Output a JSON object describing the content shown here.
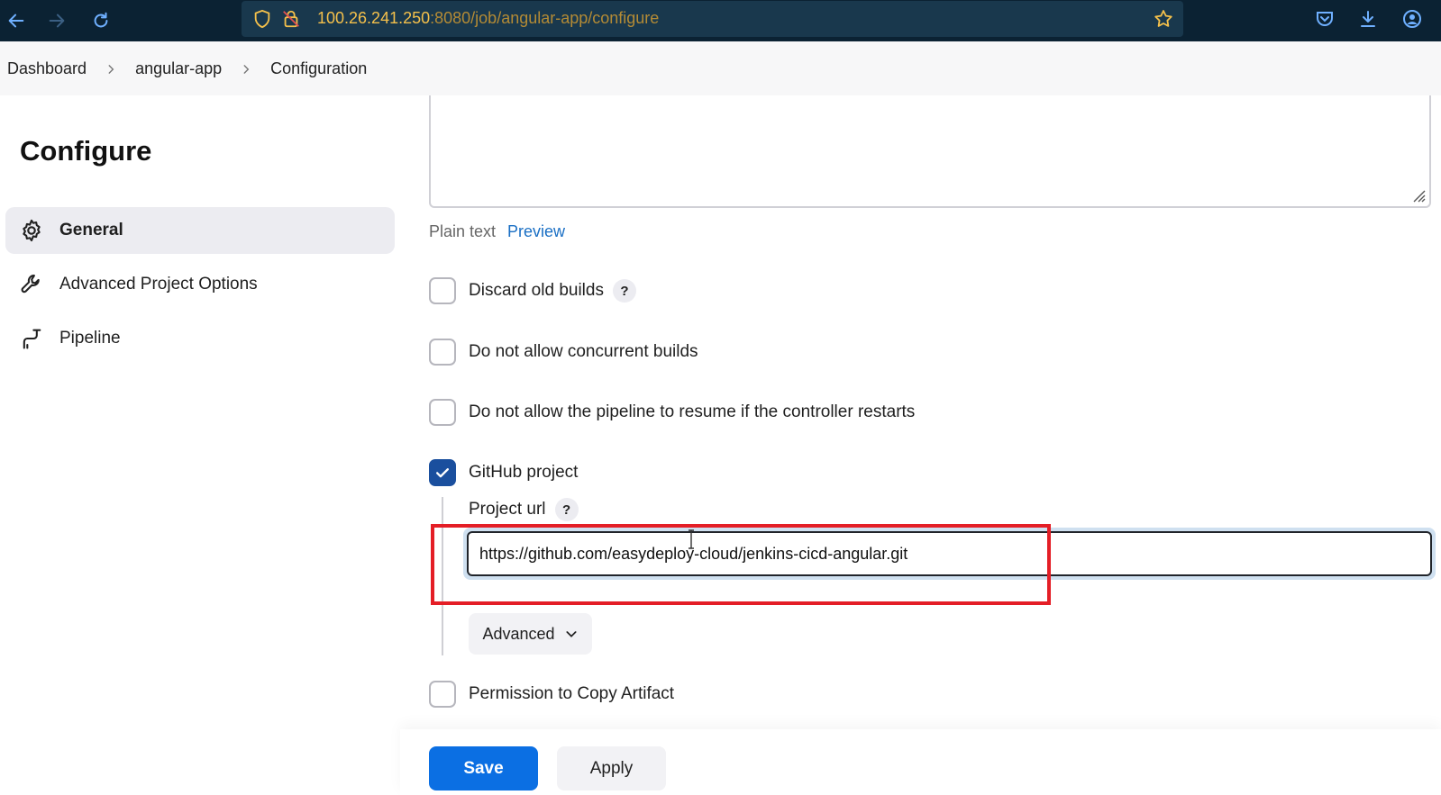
{
  "browser": {
    "url_host": "100.26.241.250",
    "url_path": ":8080/job/angular-app/configure"
  },
  "breadcrumb": {
    "items": [
      "Dashboard",
      "angular-app",
      "Configuration"
    ]
  },
  "sidebar": {
    "title": "Configure",
    "items": [
      {
        "label": "General",
        "icon": "gear-icon",
        "active": true
      },
      {
        "label": "Advanced Project Options",
        "icon": "wrench-icon",
        "active": false
      },
      {
        "label": "Pipeline",
        "icon": "pipeline-icon",
        "active": false
      }
    ]
  },
  "description": {
    "plain_text_label": "Plain text",
    "preview_label": "Preview"
  },
  "options": [
    {
      "label": "Discard old builds",
      "checked": false,
      "help": "?"
    },
    {
      "label": "Do not allow concurrent builds",
      "checked": false
    },
    {
      "label": "Do not allow the pipeline to resume if the controller restarts",
      "checked": false
    },
    {
      "label": "GitHub project",
      "checked": true
    },
    {
      "label": "Permission to Copy Artifact",
      "checked": false
    }
  ],
  "github": {
    "project_url_label": "Project url",
    "help": "?",
    "project_url_value": "https://github.com/easydeploy-cloud/jenkins-cicd-angular.git",
    "advanced_label": "Advanced"
  },
  "actions": {
    "save_label": "Save",
    "apply_label": "Apply"
  },
  "colors": {
    "primary": "#0b6fe3",
    "checkbox_checked": "#1a4f9e",
    "highlight": "#e41e26",
    "link": "#1a6fc4"
  }
}
